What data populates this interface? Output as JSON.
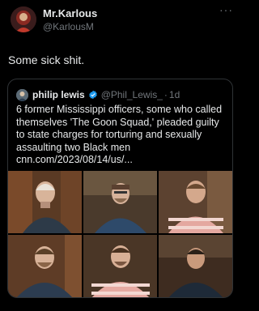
{
  "tweet": {
    "author_name": "Mr.Karlous",
    "author_handle": "@KarlousM",
    "more_label": "···",
    "text": "Some sick shit."
  },
  "quote": {
    "author_name": "philip lewis",
    "author_handle": "@Phil_Lewis_",
    "separator": "·",
    "time": "1d",
    "text": "6 former Mississippi officers, some who called themselves 'The Goon Squad,' pleaded guilty to state charges for torturing and sexually assaulting two Black men cnn.com/2023/08/14/us/..."
  },
  "icons": {
    "avatar": "avatar-image",
    "verified": "verified-badge-icon",
    "more": "more-options-icon"
  },
  "colors": {
    "background": "#000000",
    "text": "#e7e9ea",
    "muted": "#71767b",
    "border": "#2f3336",
    "verified": "#1d9bf0"
  }
}
